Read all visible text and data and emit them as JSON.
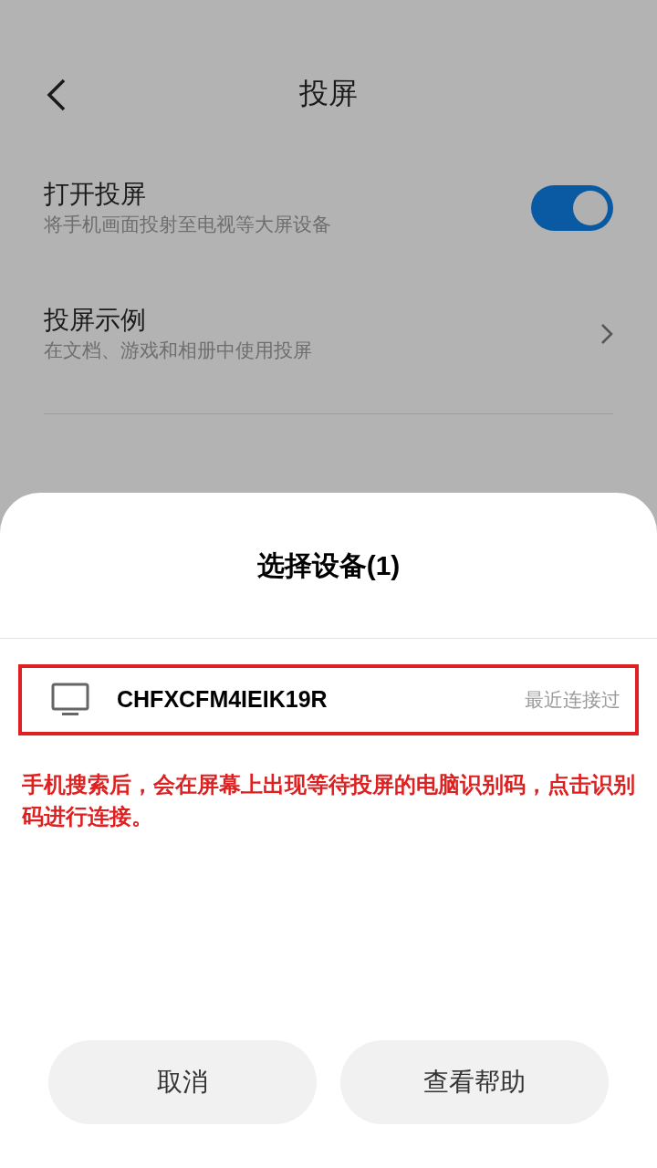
{
  "header": {
    "title": "投屏"
  },
  "settings": [
    {
      "kind": "toggle",
      "title": "打开投屏",
      "subtitle": "将手机画面投射至电视等大屏设备",
      "on": true
    },
    {
      "kind": "link",
      "title": "投屏示例",
      "subtitle": "在文档、游戏和相册中使用投屏"
    }
  ],
  "sheet": {
    "title": "选择设备(1)",
    "devices": [
      {
        "name": "CHFXCFM4IEIK19R",
        "status": "最近连接过",
        "highlighted": true
      }
    ],
    "annotation": "手机搜索后，会在屏幕上出现等待投屏的电脑识别码，点击识别码进行连接。",
    "buttons": [
      "取消",
      "查看帮助"
    ]
  }
}
